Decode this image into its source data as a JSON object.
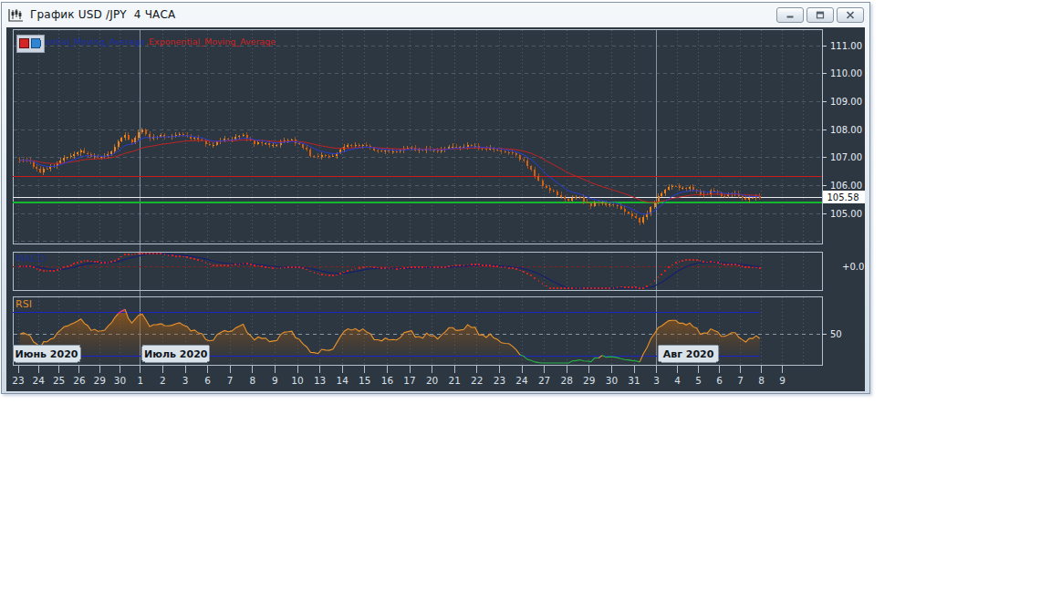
{
  "window": {
    "title": "График USD /JPY  4 ЧАСА",
    "controls": [
      {
        "name": "minimize"
      },
      {
        "name": "restore"
      },
      {
        "name": "close"
      }
    ]
  },
  "legend": {
    "series1": "Exponential_Moving_Average",
    "series2": ".Exponential_Moving_Average",
    "chip_colors": [
      "#d42626",
      "#2e86d2"
    ]
  },
  "price_scale": {
    "current": "105.58",
    "ticks": [
      "111.00",
      "110.00",
      "109.00",
      "108.00",
      "107.00",
      "106.00",
      "105.00"
    ]
  },
  "macd_panel": {
    "label": "MACD",
    "value_label": "+0.0"
  },
  "rsi_panel": {
    "label": "RSI",
    "mid_label": "50"
  },
  "x_axis": {
    "labels": [
      "23",
      "24",
      "25",
      "26",
      "29",
      "30",
      "1",
      "2",
      "3",
      "6",
      "7",
      "8",
      "9",
      "10",
      "13",
      "14",
      "15",
      "16",
      "17",
      "20",
      "21",
      "22",
      "23",
      "24",
      "27",
      "28",
      "29",
      "30",
      "31",
      "3",
      "4",
      "5",
      "6",
      "7",
      "8",
      "9"
    ],
    "month_badges": [
      {
        "label": "Июнь 2020",
        "day_index": 0
      },
      {
        "label": "Июль 2020",
        "day_index": 6
      },
      {
        "label": "Авг 2020",
        "day_index": 29
      }
    ]
  },
  "chart_data": {
    "type": "candlestick",
    "symbol": "USD/JPY",
    "timeframe": "4 HOURS",
    "title": "График USD /JPY 4 ЧАСА",
    "y_axis": {
      "min": 104.0,
      "max": 111.6,
      "tick_step": 1.0,
      "ticks": [
        111,
        110,
        109,
        108,
        107,
        106,
        105
      ]
    },
    "x_days": [
      "Jun 23",
      "Jun 24",
      "Jun 25",
      "Jun 26",
      "Jun 29",
      "Jun 30",
      "Jul 1",
      "Jul 2",
      "Jul 3",
      "Jul 6",
      "Jul 7",
      "Jul 8",
      "Jul 9",
      "Jul 10",
      "Jul 13",
      "Jul 14",
      "Jul 15",
      "Jul 16",
      "Jul 17",
      "Jul 20",
      "Jul 21",
      "Jul 22",
      "Jul 23",
      "Jul 24",
      "Jul 27",
      "Jul 28",
      "Jul 29",
      "Jul 30",
      "Jul 31",
      "Aug 3",
      "Aug 4",
      "Aug 5",
      "Aug 6",
      "Aug 7"
    ],
    "candles_per_day": 6,
    "price_anchors": [
      [
        0,
        106.9
      ],
      [
        3,
        106.82
      ],
      [
        6,
        106.45
      ],
      [
        10,
        106.78
      ],
      [
        15,
        107.1
      ],
      [
        18,
        107.15
      ],
      [
        24,
        107.0
      ],
      [
        28,
        107.4
      ],
      [
        31,
        107.8
      ],
      [
        33,
        107.5
      ],
      [
        36,
        108.0
      ],
      [
        38,
        107.75
      ],
      [
        42,
        107.8
      ],
      [
        48,
        107.75
      ],
      [
        54,
        107.5
      ],
      [
        58,
        107.65
      ],
      [
        63,
        107.72
      ],
      [
        66,
        107.55
      ],
      [
        72,
        107.5
      ],
      [
        76,
        107.62
      ],
      [
        81,
        107.12
      ],
      [
        86,
        107.05
      ],
      [
        90,
        107.32
      ],
      [
        93,
        107.45
      ],
      [
        96,
        107.4
      ],
      [
        102,
        107.2
      ],
      [
        108,
        107.3
      ],
      [
        114,
        107.3
      ],
      [
        120,
        107.35
      ],
      [
        126,
        107.42
      ],
      [
        129,
        107.32
      ],
      [
        132,
        107.25
      ],
      [
        138,
        106.9
      ],
      [
        141,
        106.35
      ],
      [
        144,
        105.95
      ],
      [
        147,
        105.65
      ],
      [
        150,
        105.45
      ],
      [
        153,
        105.58
      ],
      [
        156,
        105.32
      ],
      [
        159,
        105.44
      ],
      [
        162,
        105.25
      ],
      [
        166,
        105.0
      ],
      [
        169,
        104.68
      ],
      [
        171,
        105.1
      ],
      [
        174,
        105.6
      ],
      [
        177,
        105.98
      ],
      [
        180,
        105.85
      ],
      [
        183,
        105.95
      ],
      [
        186,
        105.72
      ],
      [
        189,
        105.82
      ],
      [
        192,
        105.62
      ],
      [
        195,
        105.68
      ],
      [
        198,
        105.58
      ],
      [
        203,
        105.6
      ]
    ],
    "levels": {
      "resistance_red": 106.33,
      "current_white": 105.58,
      "support_green": 105.41
    },
    "last_price": 105.58,
    "moving_averages": [
      {
        "name": "Exponential_Moving_Average",
        "color": "#2a3cd4",
        "period": 6
      },
      {
        "name": "Exponential_Moving_Average",
        "color": "#c32222",
        "period": 30
      }
    ],
    "macd": {
      "fast": 12,
      "slow": 26,
      "signal_period": 9,
      "zero_label": "+0.0",
      "dot_color": "#d42222",
      "signal_color": "#151e70"
    },
    "rsi": {
      "period": 14,
      "upper": 70,
      "mid": 50,
      "lower": 30,
      "line_color": "#e8932c",
      "oversold_color": "#27b244",
      "overbought_color": "#f23a9a",
      "band_color": "#1a24cc"
    },
    "colors": {
      "background": "#2d3742",
      "panel_border": "#b2bfcc",
      "grid": "#4f5b69",
      "month_line": "#8593a2",
      "candle_up": "#ee8117",
      "candle_down": "#d2600e",
      "axis_text": "#e9eef4",
      "strip_text": "#d9e0e8"
    }
  }
}
